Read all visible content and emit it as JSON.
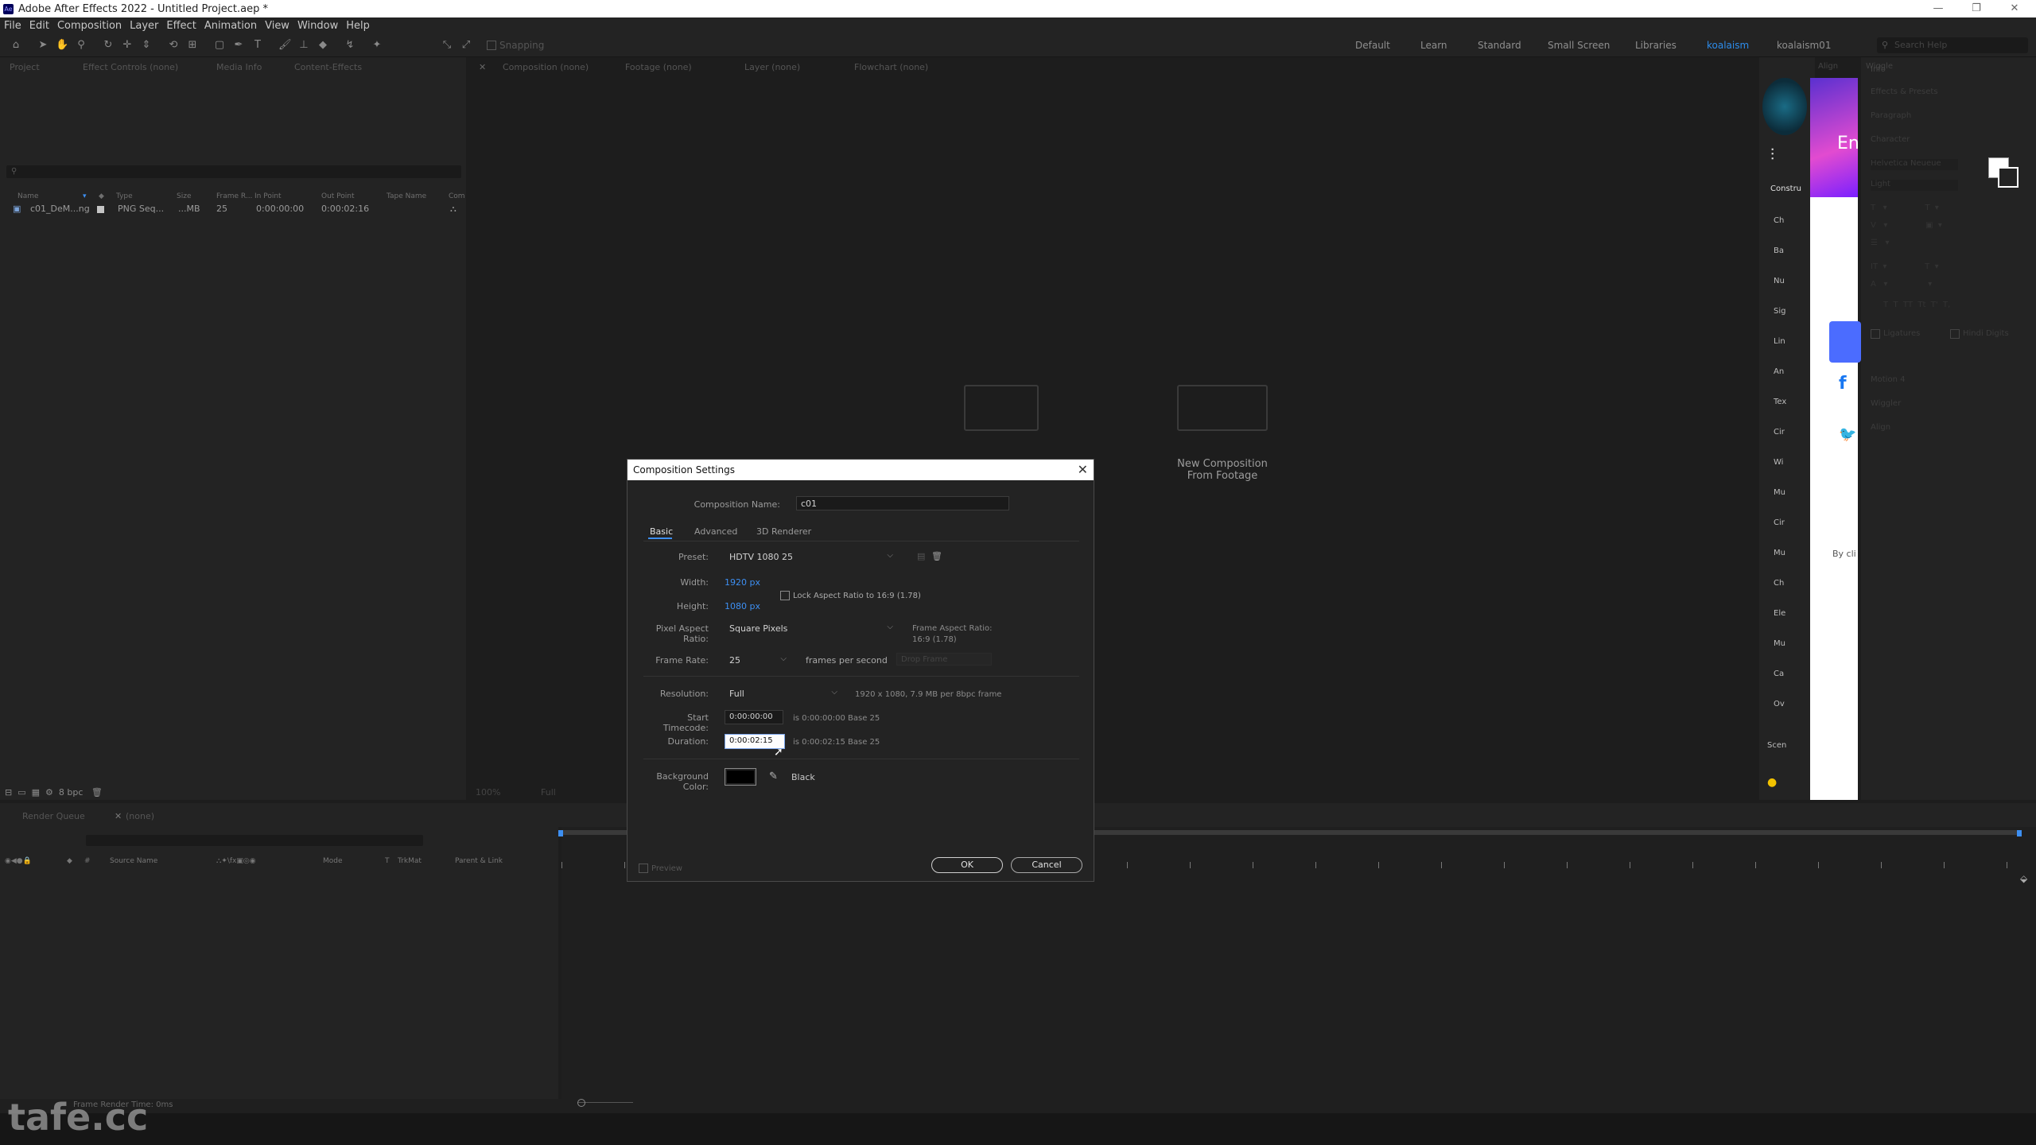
{
  "app": {
    "title": "Adobe After Effects 2022 - Untitled Project.aep *",
    "icon_text": "Ae"
  },
  "menu": [
    "File",
    "Edit",
    "Composition",
    "Layer",
    "Effect",
    "Animation",
    "View",
    "Window",
    "Help"
  ],
  "toolbar": {
    "snapping_label": "Snapping",
    "workspaces": [
      "Default",
      "Learn",
      "Standard",
      "Small Screen",
      "Libraries",
      "koalaism",
      "koalaism01"
    ],
    "active_workspace": "koalaism",
    "search_placeholder": "Search Help"
  },
  "project_panel": {
    "tabs": [
      "Project",
      "Effect Controls (none)",
      "Media Info",
      "Content-Effects"
    ],
    "columns": [
      "Name",
      "Type",
      "Size",
      "Frame R...",
      "In Point",
      "Out Point",
      "Tape Name",
      "Com"
    ],
    "items": [
      {
        "name": "c01_DeM...ng",
        "type": "PNG Seq...",
        "size": "...MB",
        "frame_rate": "25",
        "in_point": "0:00:00:00",
        "out_point": "0:00:02:16"
      }
    ],
    "bpc": "8 bpc"
  },
  "viewer": {
    "tabs": [
      "Composition (none)",
      "Footage (none)",
      "Layer (none)",
      "Flowchart (none)"
    ],
    "new_comp_from_footage": "New Composition\nFrom Footage",
    "zoom": "100%",
    "quality": "Full"
  },
  "timeline": {
    "tabs": [
      "Render Queue",
      "(none)"
    ],
    "columns": [
      "Source Name",
      "Mode",
      "T",
      "TrkMat",
      "Parent & Link"
    ],
    "status": "Frame Render Time: 0ms"
  },
  "right_panel": {
    "browser_text": "En",
    "by_text": "By cli",
    "construct_label": "Constru",
    "list_items": [
      "Ch",
      "Ba",
      "Nu",
      "Sig",
      "Lin",
      "An",
      "Tex",
      "Cir",
      "Wi",
      "Mu",
      "Cir",
      "Mu",
      "Ch",
      "Ele",
      "Mu",
      "Ca",
      "Ov"
    ],
    "scene_label": "Scen"
  },
  "character_panel": {
    "tabs": [
      "Align",
      "Wiggle",
      "Info"
    ],
    "sections": [
      "Effects & Presets",
      "Paragraph",
      "Character"
    ],
    "font": "Helvetica Neueue",
    "style": "Light",
    "bottom_items": [
      "Motion 4",
      "Wiggler",
      "Align"
    ],
    "checkbox_labels": [
      "Ligatures",
      "Hindi Digits"
    ]
  },
  "dialog": {
    "title": "Composition Settings",
    "comp_name_label": "Composition Name:",
    "comp_name": "c01",
    "tabs": [
      "Basic",
      "Advanced",
      "3D Renderer"
    ],
    "active_tab": "Basic",
    "preset_label": "Preset:",
    "preset": "HDTV 1080 25",
    "width_label": "Width:",
    "width": "1920 px",
    "height_label": "Height:",
    "height": "1080 px",
    "lock_aspect": "Lock Aspect Ratio to 16:9 (1.78)",
    "pixel_aspect_label": "Pixel Aspect Ratio:",
    "pixel_aspect": "Square Pixels",
    "frame_aspect": "Frame Aspect Ratio:\n16:9 (1.78)",
    "frame_rate_label": "Frame Rate:",
    "frame_rate": "25",
    "fps_text": "frames per second",
    "drop_frame": "Drop Frame",
    "resolution_label": "Resolution:",
    "resolution": "Full",
    "resolution_info": "1920 x 1080, 7.9 MB per 8bpc frame",
    "start_tc_label": "Start Timecode:",
    "start_tc": "0:00:00:00",
    "start_tc_info": "is 0:00:00:00  Base 25",
    "duration_label": "Duration:",
    "duration": "0:00:02:15",
    "duration_info": "is 0:00:02:15  Base 25",
    "bg_label": "Background Color:",
    "bg_color": "#000000",
    "bg_name": "Black",
    "preview_label": "Preview",
    "ok": "OK",
    "cancel": "Cancel"
  },
  "watermark": "tafe.cc",
  "colors": {
    "accent": "#3d8ff2",
    "workspace_active": "#2d8ceb",
    "browser_blue": "#4b6cff"
  }
}
